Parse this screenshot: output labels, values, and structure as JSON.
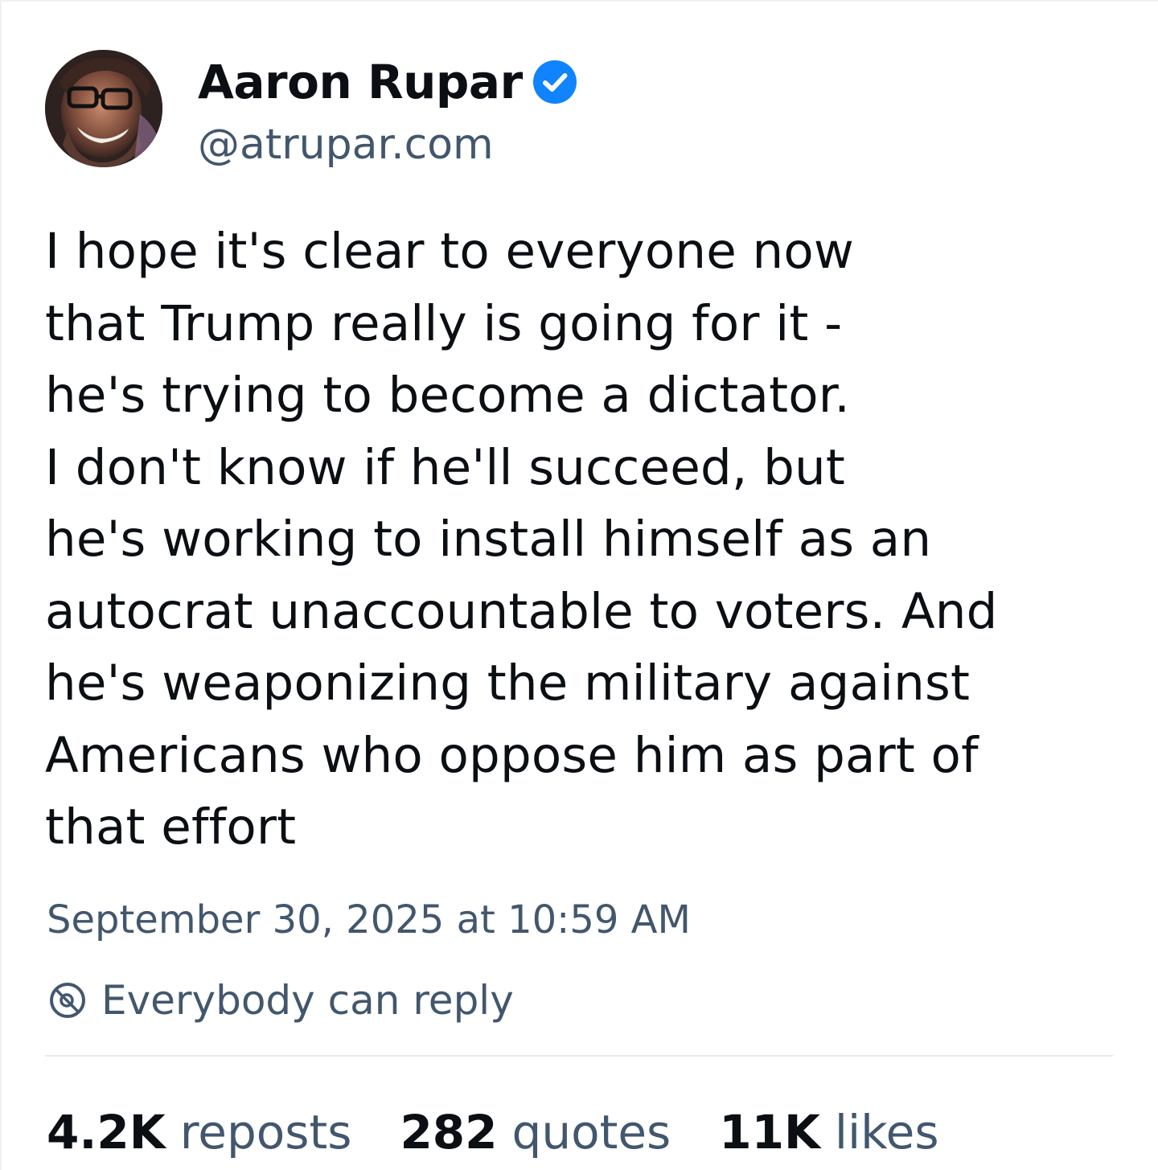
{
  "author": {
    "display_name": "Aaron Rupar",
    "handle": "@atrupar.com",
    "verified": true,
    "avatar_icon": "user-avatar",
    "verified_icon": "verified-badge-icon"
  },
  "post": {
    "text": "I hope it's clear to everyone now\nthat Trump really is going for it -\nhe's trying to become a dictator.\nI don't know if he'll succeed, but\nhe's working to install himself as an\nautocrat unaccountable to voters. And\nhe's weaponizing the military against\nAmericans who oppose him as part of\nthat effort",
    "timestamp": "September 30, 2025 at 10:59 AM"
  },
  "reply_settings": {
    "icon": "reply-settings-icon",
    "label": "Everybody can reply"
  },
  "stats": [
    {
      "count": "4.2K",
      "label": "reposts"
    },
    {
      "count": "282",
      "label": "quotes"
    },
    {
      "count": "11K",
      "label": "likes"
    }
  ],
  "colors": {
    "text": "#0b0f14",
    "secondary_text": "#42576d",
    "verified_blue": "#1083fe",
    "divider": "#e7eaee",
    "background": "#ffffff"
  }
}
